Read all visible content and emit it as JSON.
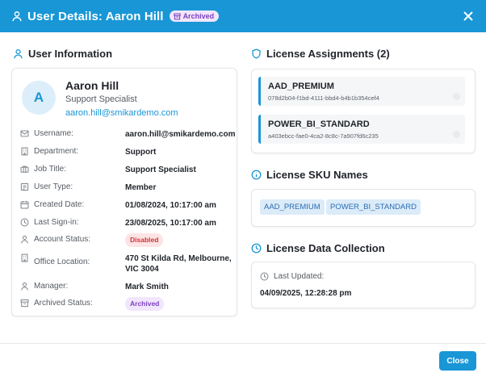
{
  "header": {
    "title": "User Details: Aaron Hill",
    "badge": "Archived"
  },
  "user_info": {
    "section_title": "User Information",
    "avatar_initial": "A",
    "name": "Aaron Hill",
    "role": "Support Specialist",
    "email": "aaron.hill@smikardemo.com",
    "fields": [
      {
        "label": "Username:",
        "value": "aaron.hill@smikardemo.com",
        "icon": "mail-icon"
      },
      {
        "label": "Department:",
        "value": "Support",
        "icon": "building-icon"
      },
      {
        "label": "Job Title:",
        "value": "Support Specialist",
        "icon": "briefcase-icon"
      },
      {
        "label": "User Type:",
        "value": "Member",
        "icon": "id-card-icon"
      },
      {
        "label": "Created Date:",
        "value": "01/08/2024, 10:17:00 am",
        "icon": "calendar-icon"
      },
      {
        "label": "Last Sign-in:",
        "value": "23/08/2025, 10:17:00 am",
        "icon": "clock-icon"
      },
      {
        "label": "Account Status:",
        "value": "Disabled",
        "icon": "user-icon"
      },
      {
        "label": "Office Location:",
        "value": "470 St Kilda Rd, Melbourne, VIC 3004",
        "icon": "office-icon"
      },
      {
        "label": "Manager:",
        "value": "Mark Smith",
        "icon": "user-icon"
      },
      {
        "label": "Archived Status:",
        "value": "Archived",
        "icon": "archive-icon"
      }
    ]
  },
  "licenses": {
    "section_title": "License Assignments (2)",
    "items": [
      {
        "name": "AAD_PREMIUM",
        "id": "078d2b04-f1bd-4111-bbd4-b4b1b354cef4"
      },
      {
        "name": "POWER_BI_STANDARD",
        "id": "a403ebcc-fae0-4ca2-8c8c-7a907fd6c235"
      }
    ]
  },
  "sku": {
    "section_title": "License SKU Names",
    "names": [
      "AAD_PREMIUM",
      "POWER_BI_STANDARD"
    ]
  },
  "collection": {
    "section_title": "License Data Collection",
    "label": "Last Updated:",
    "value": "04/09/2025, 12:28:28 pm"
  },
  "footer": {
    "close_label": "Close"
  },
  "colors": {
    "accent": "#1896d6",
    "disabled": "#d13438",
    "archived": "#7b3fbf"
  }
}
